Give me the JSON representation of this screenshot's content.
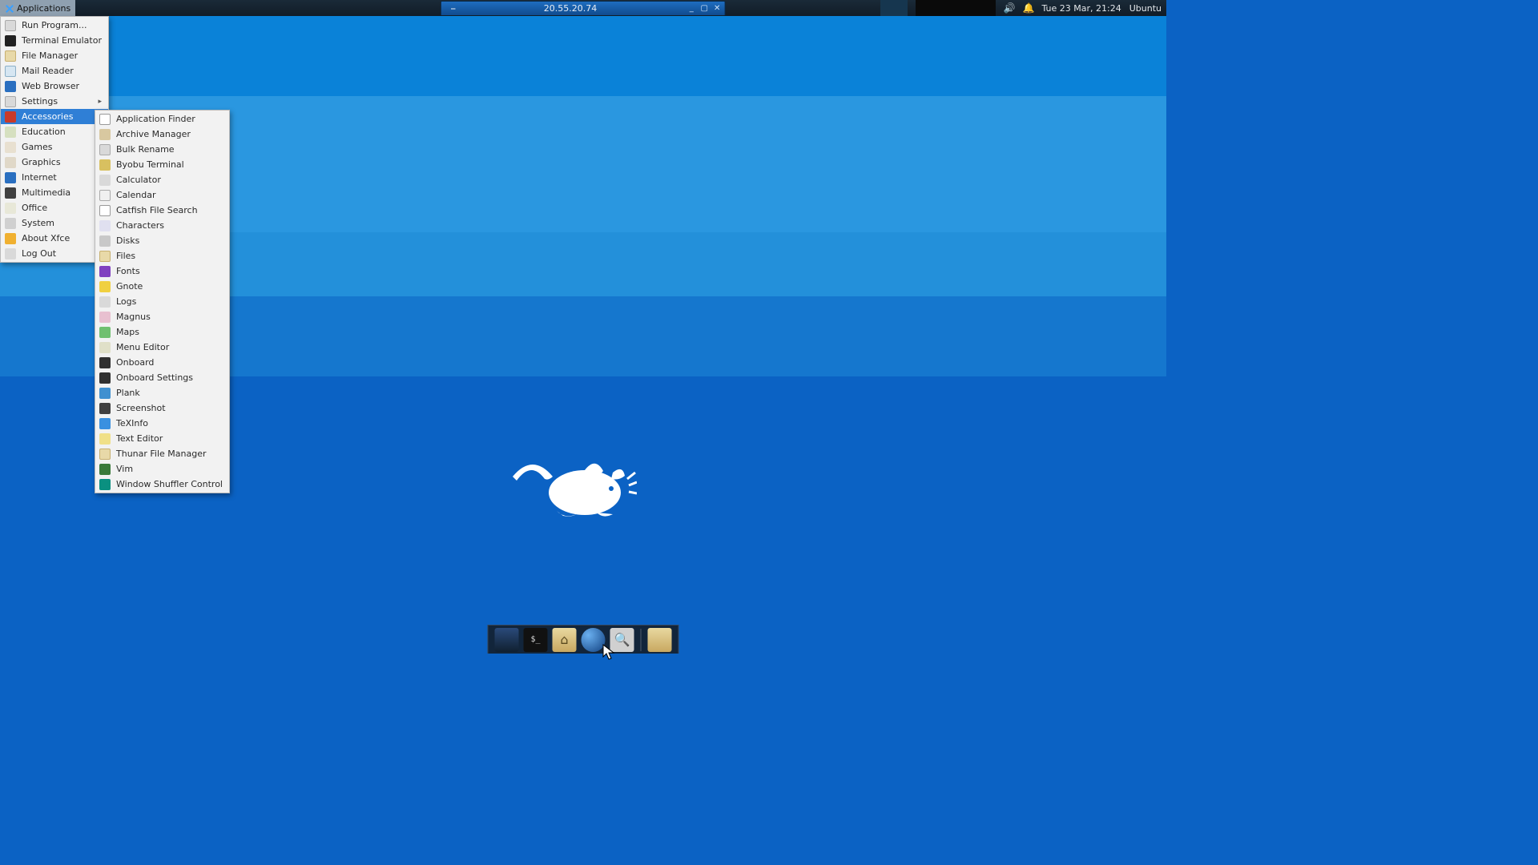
{
  "panel": {
    "apps_label": "Applications",
    "window_title": "20.55.20.74",
    "clock": "Tue 23 Mar, 21:24",
    "user": "Ubuntu"
  },
  "main_menu": [
    {
      "label": "Run Program...",
      "icon": "ic-gray",
      "arrow": false
    },
    {
      "label": "Terminal Emulator",
      "icon": "ic-term",
      "arrow": false
    },
    {
      "label": "File Manager",
      "icon": "ic-folder",
      "arrow": false
    },
    {
      "label": "Mail Reader",
      "icon": "ic-mail",
      "arrow": false
    },
    {
      "label": "Web Browser",
      "icon": "ic-globe",
      "arrow": false
    },
    {
      "label": "Settings",
      "icon": "ic-gear",
      "arrow": true
    },
    {
      "label": "Accessories",
      "icon": "ic-red",
      "arrow": true,
      "selected": true
    },
    {
      "label": "Education",
      "icon": "ic-edu",
      "arrow": true
    },
    {
      "label": "Games",
      "icon": "ic-game",
      "arrow": true
    },
    {
      "label": "Graphics",
      "icon": "ic-gfx",
      "arrow": true
    },
    {
      "label": "Internet",
      "icon": "ic-globe",
      "arrow": true
    },
    {
      "label": "Multimedia",
      "icon": "ic-mm",
      "arrow": true
    },
    {
      "label": "Office",
      "icon": "ic-office",
      "arrow": true
    },
    {
      "label": "System",
      "icon": "ic-sys",
      "arrow": true
    },
    {
      "label": "About Xfce",
      "icon": "ic-star",
      "arrow": false
    },
    {
      "label": "Log Out",
      "icon": "ic-out",
      "arrow": false
    }
  ],
  "accessories_menu": [
    {
      "label": "Application Finder",
      "icon": "ic-search"
    },
    {
      "label": "Archive Manager",
      "icon": "ic-box"
    },
    {
      "label": "Bulk Rename",
      "icon": "ic-gray"
    },
    {
      "label": "Byobu Terminal",
      "icon": "ic-byobu"
    },
    {
      "label": "Calculator",
      "icon": "ic-calc"
    },
    {
      "label": "Calendar",
      "icon": "ic-cal"
    },
    {
      "label": "Catfish File Search",
      "icon": "ic-search"
    },
    {
      "label": "Characters",
      "icon": "ic-chars"
    },
    {
      "label": "Disks",
      "icon": "ic-disk"
    },
    {
      "label": "Files",
      "icon": "ic-folder"
    },
    {
      "label": "Fonts",
      "icon": "ic-font"
    },
    {
      "label": "Gnote",
      "icon": "ic-note"
    },
    {
      "label": "Logs",
      "icon": "ic-log"
    },
    {
      "label": "Magnus",
      "icon": "ic-magnus"
    },
    {
      "label": "Maps",
      "icon": "ic-maps"
    },
    {
      "label": "Menu Editor",
      "icon": "ic-menue"
    },
    {
      "label": "Onboard",
      "icon": "ic-ob"
    },
    {
      "label": "Onboard Settings",
      "icon": "ic-ob"
    },
    {
      "label": "Plank",
      "icon": "ic-plank"
    },
    {
      "label": "Screenshot",
      "icon": "ic-shot"
    },
    {
      "label": "TeXInfo",
      "icon": "ic-info"
    },
    {
      "label": "Text Editor",
      "icon": "ic-txt"
    },
    {
      "label": "Thunar File Manager",
      "icon": "ic-folder"
    },
    {
      "label": "Vim",
      "icon": "ic-vim"
    },
    {
      "label": "Window Shuffler Control",
      "icon": "ic-ws"
    }
  ],
  "dock": {
    "items": [
      {
        "name": "show-desktop",
        "cls": "di-desktop"
      },
      {
        "name": "terminal",
        "cls": "di-term"
      },
      {
        "name": "file-manager",
        "cls": "di-home"
      },
      {
        "name": "web-browser",
        "cls": "di-browser"
      },
      {
        "name": "app-finder",
        "cls": "di-search"
      }
    ],
    "user_dir": {
      "name": "user-folder",
      "cls": "di-folder"
    }
  }
}
